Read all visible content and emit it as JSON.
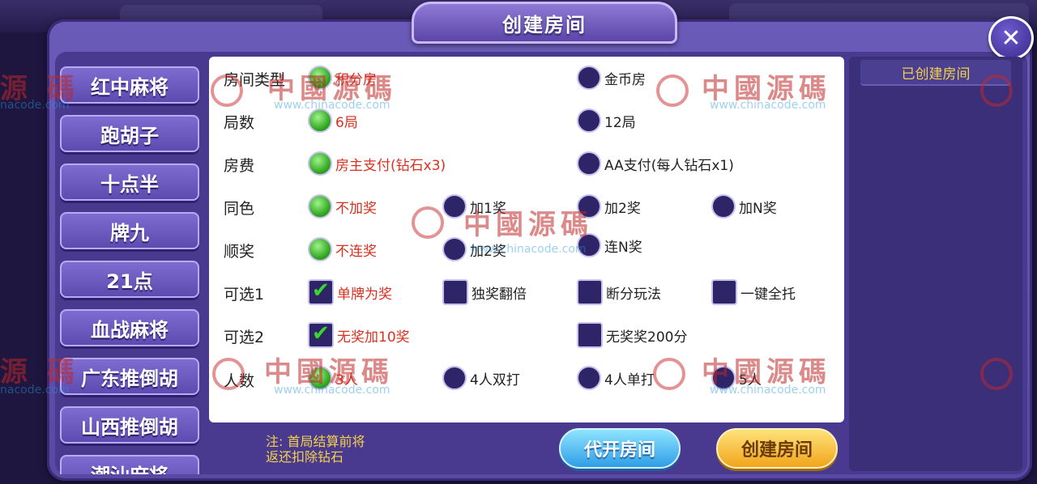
{
  "window": {
    "title": "创建房间"
  },
  "sidebar": {
    "items": [
      {
        "label": "红中麻将"
      },
      {
        "label": "跑胡子"
      },
      {
        "label": "十点半"
      },
      {
        "label": "牌九"
      },
      {
        "label": "21点"
      },
      {
        "label": "血战麻将"
      },
      {
        "label": "广东推倒胡"
      },
      {
        "label": "山西推倒胡"
      },
      {
        "label": "潮汕麻将"
      }
    ]
  },
  "settings": {
    "rows": [
      {
        "label": "房间类型",
        "options": [
          {
            "label": "积分房",
            "selected": true
          },
          {
            "label": "金币房",
            "selected": false
          }
        ]
      },
      {
        "label": "局数",
        "options": [
          {
            "label": "6局",
            "selected": true
          },
          {
            "label": "12局",
            "selected": false
          }
        ]
      },
      {
        "label": "房费",
        "options": [
          {
            "label": "房主支付(钻石x3)",
            "selected": true
          },
          {
            "label": "AA支付(每人钻石x1)",
            "selected": false
          }
        ]
      },
      {
        "label": "同色",
        "options": [
          {
            "label": "不加奖",
            "selected": true
          },
          {
            "label": "加1奖",
            "selected": false
          },
          {
            "label": "加2奖",
            "selected": false
          },
          {
            "label": "加N奖",
            "selected": false
          }
        ]
      },
      {
        "label": "顺奖",
        "options": [
          {
            "label": "不连奖",
            "selected": true
          },
          {
            "label": "加2奖",
            "selected": false
          },
          {
            "label": "连N奖",
            "selected": false
          }
        ]
      },
      {
        "label": "可选1",
        "options": [
          {
            "label": "单牌为奖",
            "selected": true
          },
          {
            "label": "独奖翻倍",
            "selected": false
          },
          {
            "label": "断分玩法",
            "selected": false
          },
          {
            "label": "一键全托",
            "selected": false
          }
        ]
      },
      {
        "label": "可选2",
        "options": [
          {
            "label": "无奖加10奖",
            "selected": true
          },
          {
            "label": "无奖奖200分",
            "selected": false
          }
        ]
      },
      {
        "label": "人数",
        "options": [
          {
            "label": "3人",
            "selected": true
          },
          {
            "label": "4人双打",
            "selected": false
          },
          {
            "label": "4人单打",
            "selected": false
          },
          {
            "label": "5人",
            "selected": false
          }
        ]
      }
    ]
  },
  "footer": {
    "note_line1": "注: 首局结算前将",
    "note_line2": "返还扣除钻石",
    "proxy_button": "代开房间",
    "create_button": "创建房间"
  },
  "created_rooms": {
    "title": "已创建房间"
  },
  "watermark": {
    "text": "中國源碼",
    "url": "www.chinacode.com",
    "partial_text": "源 碼",
    "partial_url": "nacode.com"
  },
  "icons": {
    "close": "close-icon",
    "watermark_logo": "watermark-logo-icon"
  },
  "colors": {
    "selected_text": "#d9301f",
    "note_text": "#f3d24a",
    "radio_on": "#2fa51e",
    "panel": "#5a49a3"
  }
}
